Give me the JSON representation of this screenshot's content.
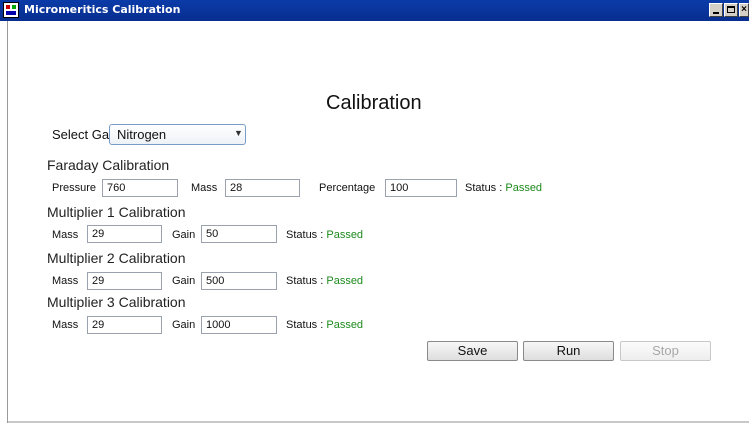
{
  "window": {
    "title": "Micromeritics Calibration"
  },
  "page": {
    "heading": "Calibration"
  },
  "gas": {
    "label": "Select Gas",
    "selected": "Nitrogen"
  },
  "faraday": {
    "title": "Faraday Calibration",
    "pressure_label": "Pressure",
    "pressure_value": "760",
    "mass_label": "Mass",
    "mass_value": "28",
    "percentage_label": "Percentage",
    "percentage_value": "100",
    "status_label": "Status :",
    "status_value": "Passed"
  },
  "multiplier1": {
    "title": "Multiplier 1 Calibration",
    "mass_label": "Mass",
    "mass_value": "29",
    "gain_label": "Gain",
    "gain_value": "50",
    "status_label": "Status :",
    "status_value": "Passed"
  },
  "multiplier2": {
    "title": "Multiplier 2 Calibration",
    "mass_label": "Mass",
    "mass_value": "29",
    "gain_label": "Gain",
    "gain_value": "500",
    "status_label": "Status :",
    "status_value": "Passed"
  },
  "multiplier3": {
    "title": "Multiplier 3 Calibration",
    "mass_label": "Mass",
    "mass_value": "29",
    "gain_label": "Gain",
    "gain_value": "1000",
    "status_label": "Status :",
    "status_value": "Passed"
  },
  "actions": {
    "save": "Save",
    "run": "Run",
    "stop": "Stop"
  },
  "colors": {
    "titlebar": "#0a3ba8",
    "status_passed": "#1d8a1d",
    "disabled_text": "#a7a7a7"
  }
}
